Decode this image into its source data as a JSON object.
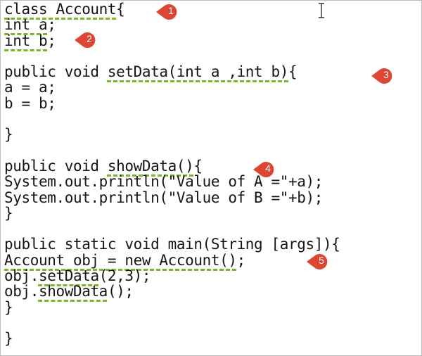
{
  "code_lines": [
    {
      "segments": [
        {
          "t": "class Account",
          "sq": true
        },
        {
          "t": "{"
        }
      ]
    },
    {
      "segments": [
        {
          "t": "int a",
          "sq": true
        },
        {
          "t": ";"
        }
      ]
    },
    {
      "segments": [
        {
          "t": "int b",
          "sq": true
        },
        {
          "t": ";"
        }
      ]
    },
    {
      "segments": []
    },
    {
      "segments": [
        {
          "t": "public void "
        },
        {
          "t": "setData(int a ,int b)",
          "sq": true
        },
        {
          "t": "{"
        }
      ]
    },
    {
      "segments": [
        {
          "t": "a = a;"
        }
      ]
    },
    {
      "segments": [
        {
          "t": "b = b;"
        }
      ]
    },
    {
      "segments": []
    },
    {
      "segments": [
        {
          "t": "}"
        }
      ]
    },
    {
      "segments": []
    },
    {
      "segments": [
        {
          "t": "public void "
        },
        {
          "t": "showData()",
          "sq": true
        },
        {
          "t": "{"
        }
      ]
    },
    {
      "segments": [
        {
          "t": "System.out.println(\"Value of A =\"+a);"
        }
      ]
    },
    {
      "segments": [
        {
          "t": "System.out.println(\"Value of B =\"+b);"
        }
      ]
    },
    {
      "segments": [
        {
          "t": "}"
        }
      ]
    },
    {
      "segments": []
    },
    {
      "segments": [
        {
          "t": "public static void main(String [args]){"
        }
      ]
    },
    {
      "segments": [
        {
          "t": "Account obj = new Account()",
          "sq": true
        },
        {
          "t": ";"
        }
      ]
    },
    {
      "segments": [
        {
          "t": "obj.",
          "sq": false
        },
        {
          "t": "setData",
          "sq": true
        },
        {
          "t": "(2,3);"
        }
      ]
    },
    {
      "segments": [
        {
          "t": "obj."
        },
        {
          "t": "showData",
          "sq": true
        },
        {
          "t": "();"
        }
      ]
    },
    {
      "segments": [
        {
          "t": "}"
        }
      ]
    },
    {
      "segments": []
    },
    {
      "segments": [
        {
          "t": "}"
        }
      ]
    }
  ],
  "markers": [
    {
      "label": "1"
    },
    {
      "label": "2"
    },
    {
      "label": "3"
    },
    {
      "label": "4"
    },
    {
      "label": "5"
    }
  ],
  "colors": {
    "marker": "#dd4535",
    "squiggle": "#7ab52a",
    "text": "#151515"
  },
  "icons": {
    "cursor": "text-ibeam-cursor-icon"
  }
}
